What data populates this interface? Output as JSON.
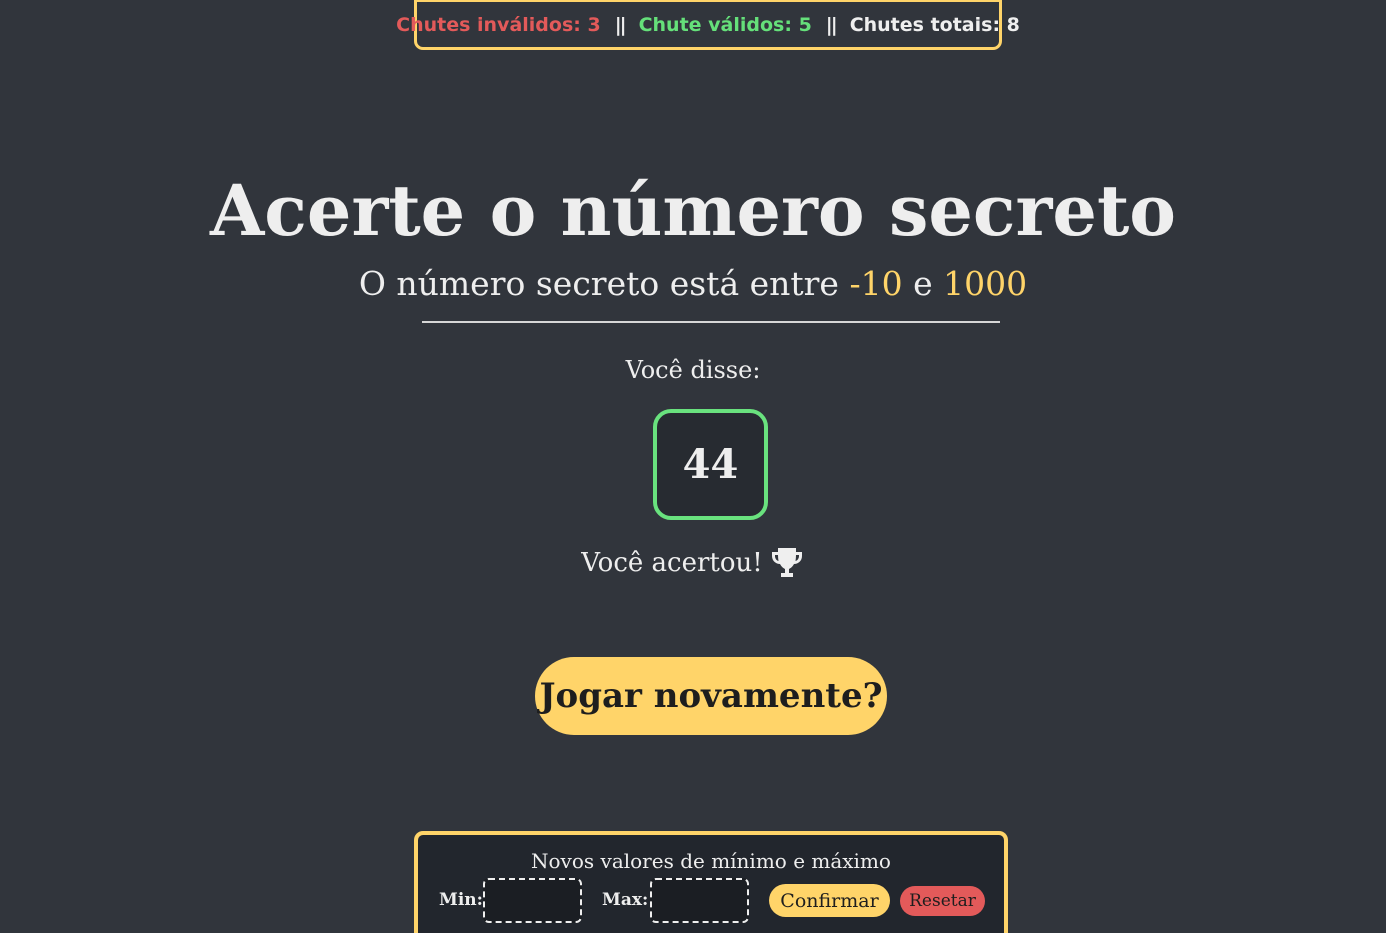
{
  "stats": {
    "invalid": "Chutes inválidos: 3",
    "valid": "Chute válidos: 5",
    "total": "Chutes totais: 8",
    "separator": "||"
  },
  "header": {
    "title": "Acerte o número secreto",
    "subtitle_prefix": "O número secreto está entre",
    "min": "-10",
    "connector": "e",
    "max": "1000"
  },
  "guess": {
    "label": "Você disse:",
    "value": "44",
    "result": "Você acertou!",
    "result_icon": "trophy-icon"
  },
  "actions": {
    "play_again": "Jogar novamente?"
  },
  "settings": {
    "title": "Novos valores de mínimo e máximo",
    "min_label": "Min:",
    "max_label": "Max:",
    "min_value": "",
    "max_value": "",
    "confirm": "Confirmar",
    "reset": "Resetar"
  },
  "colors": {
    "background": "#31353c",
    "accent": "#ffd469",
    "success": "#65e07a",
    "danger": "#e35a5a"
  }
}
